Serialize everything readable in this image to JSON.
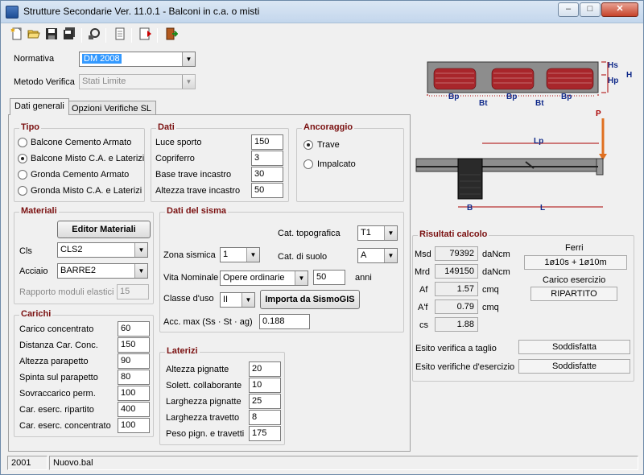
{
  "window": {
    "title": "Strutture Secondarie Ver. 11.0.1 - Balconi in c.a. o misti",
    "min_btn": "–",
    "max_btn": "□",
    "close_btn": "✕"
  },
  "toolbar": {
    "icons": [
      "new-icon",
      "open-icon",
      "save-icon",
      "save-all-icon",
      "print-preview-icon",
      "document-icon",
      "export-pdf-icon",
      "exit-icon"
    ]
  },
  "top": {
    "normativa_label": "Normativa",
    "normativa_value": "DM 2008",
    "metodo_label": "Metodo Verifica",
    "metodo_value": "Stati Limite"
  },
  "tabs": [
    {
      "label": "Dati generali",
      "active": true
    },
    {
      "label": "Opzioni Verifiche SL",
      "active": false
    }
  ],
  "tipo": {
    "title": "Tipo",
    "options": [
      "Balcone Cemento Armato",
      "Balcone Misto C.A. e Laterizi",
      "Gronda Cemento Armato",
      "Gronda Misto C.A. e Laterizi"
    ],
    "selected": 1
  },
  "dati": {
    "title": "Dati",
    "fields": [
      {
        "label": "Luce sporto",
        "value": "150"
      },
      {
        "label": "Copriferro",
        "value": "3"
      },
      {
        "label": "Base trave incastro",
        "value": "30"
      },
      {
        "label": "Altezza trave  incastro",
        "value": "50"
      }
    ]
  },
  "ancoraggio": {
    "title": "Ancoraggio",
    "options": [
      "Trave",
      "Impalcato"
    ],
    "selected": 0
  },
  "materiali": {
    "title": "Materiali",
    "editor_button": "Editor Materiali",
    "cls_label": "Cls",
    "cls_value": "CLS2",
    "acciaio_label": "Acciaio",
    "acciaio_value": "BARRE2",
    "rapporto_label": "Rapporto moduli elastici",
    "rapporto_value": "15"
  },
  "sisma": {
    "title": "Dati del sisma",
    "cat_topo_label": "Cat. topografica",
    "cat_topo_value": "T1",
    "zona_label": "Zona sismica",
    "zona_value": "1",
    "cat_suolo_label": "Cat. di suolo",
    "cat_suolo_value": "A",
    "vita_label": "Vita Nominale",
    "vita_value": "Opere ordinarie",
    "vita_years": "50",
    "anni_label": "anni",
    "classe_label": "Classe d'uso",
    "classe_value": "II",
    "importa_button": "Importa da SismoGIS",
    "acc_label": "Acc. max (Ss · St · ag)",
    "acc_value": "0.188"
  },
  "carichi": {
    "title": "Carichi",
    "fields": [
      {
        "label": "Carico concentrato",
        "value": "60"
      },
      {
        "label": "Distanza  Car. Conc.",
        "value": "150"
      },
      {
        "label": "Altezza parapetto",
        "value": "90"
      },
      {
        "label": "Spinta sul parapetto",
        "value": "80"
      },
      {
        "label": "Sovraccarico perm.",
        "value": "100"
      },
      {
        "label": "Car. eserc. ripartito",
        "value": "400"
      },
      {
        "label": "Car. eserc. concentrato",
        "value": "100"
      }
    ]
  },
  "laterizi": {
    "title": "Laterizi",
    "fields": [
      {
        "label": "Altezza pignatte",
        "value": "20"
      },
      {
        "label": "Solett. collaborante",
        "value": "10"
      },
      {
        "label": "Larghezza pignatte",
        "value": "25"
      },
      {
        "label": "Larghezza travetto",
        "value": "8"
      },
      {
        "label": "Peso pign. e travetti",
        "value": "175"
      }
    ]
  },
  "risultati": {
    "title": "Risultati calcolo",
    "rows": [
      {
        "label": "Msd",
        "value": "79392",
        "unit": "daNcm"
      },
      {
        "label": "Mrd",
        "value": "149150",
        "unit": "daNcm"
      },
      {
        "label": "Af",
        "value": "1.57",
        "unit": "cmq"
      },
      {
        "label": "A'f",
        "value": "0.79",
        "unit": "cmq"
      },
      {
        "label": "cs",
        "value": "1.88",
        "unit": ""
      }
    ],
    "ferri_label": "Ferri",
    "ferri_value": "1ø10s +   1ø10m",
    "carico_label": "Carico esercizio",
    "carico_value": "RIPARTITO",
    "taglio_label": "Esito verifica a taglio",
    "taglio_value": "Soddisfatta",
    "esercizio_label": "Esito verifiche d'esercizio",
    "esercizio_value": "Soddisfatte"
  },
  "diagram_section": {
    "hs": "Hs",
    "hp": "Hp",
    "h": "H",
    "bp": "Bp",
    "bt": "Bt"
  },
  "diagram_elevation": {
    "p": "P",
    "lp": "Lp",
    "b": "B",
    "l": "L"
  },
  "status": {
    "year": "2001",
    "file": "Nuovo.bal"
  }
}
